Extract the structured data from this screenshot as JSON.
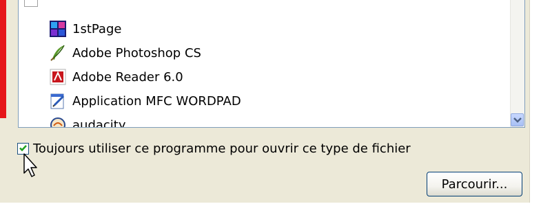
{
  "programs": [
    {
      "label": "1stPage",
      "icon": "1stpage-app-icon"
    },
    {
      "label": "Adobe Photoshop CS",
      "icon": "photoshop-feather-icon"
    },
    {
      "label": "Adobe Reader 6.0",
      "icon": "adobe-reader-icon"
    },
    {
      "label": "Application MFC WORDPAD",
      "icon": "wordpad-icon"
    },
    {
      "label": "audacity",
      "icon": "audacity-icon"
    }
  ],
  "always_use": {
    "label": "Toujours utiliser ce programme pour ouvrir ce type de fichier",
    "checked": true
  },
  "browse_button": {
    "label": "Parcourir..."
  },
  "colors": {
    "dialog_bg": "#ece9d8",
    "list_border": "#7f9db9",
    "checkmark": "#21a121",
    "scroll_arrow": "#4d6185"
  }
}
